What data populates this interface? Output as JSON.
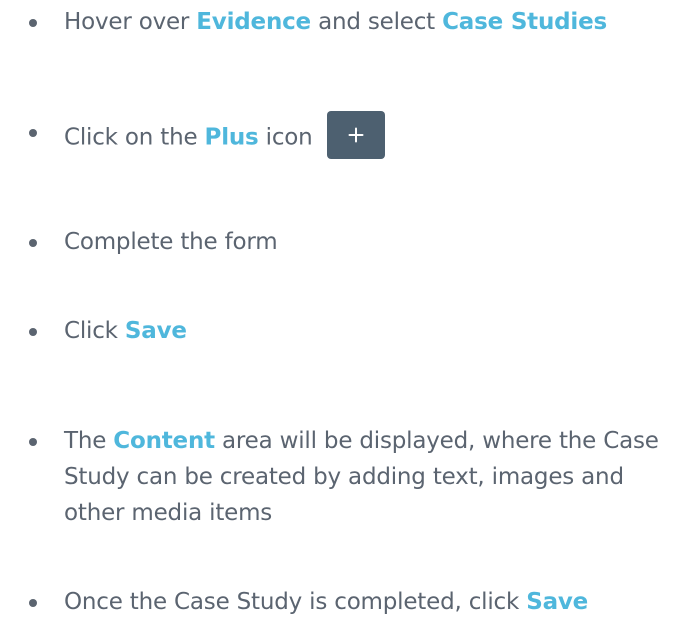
{
  "steps": [
    {
      "parts": [
        {
          "t": "Hover over ",
          "hl": false
        },
        {
          "t": "Evidence",
          "hl": true
        },
        {
          "t": " and select ",
          "hl": false
        },
        {
          "t": "Case Studies",
          "hl": true
        }
      ]
    },
    {
      "parts": [
        {
          "t": "Click on the ",
          "hl": false
        },
        {
          "t": "Plus",
          "hl": true
        },
        {
          "t": " icon",
          "hl": false
        }
      ],
      "icon": "plus-icon"
    },
    {
      "parts": [
        {
          "t": "Complete the form",
          "hl": false
        }
      ]
    },
    {
      "parts": [
        {
          "t": "Click ",
          "hl": false
        },
        {
          "t": "Save",
          "hl": true
        }
      ]
    },
    {
      "parts": [
        {
          "t": "The ",
          "hl": false
        },
        {
          "t": "Content",
          "hl": true
        },
        {
          "t": " area will be displayed, where the Case Study can be created by adding text, images and other media items",
          "hl": false
        }
      ]
    },
    {
      "parts": [
        {
          "t": "Once the Case Study is completed, click ",
          "hl": false
        },
        {
          "t": "Save",
          "hl": true
        }
      ]
    }
  ],
  "colors": {
    "text": "#5b6470",
    "highlight": "#4fb7dc",
    "button_bg": "#4d6070",
    "button_icon": "#ffffff"
  }
}
